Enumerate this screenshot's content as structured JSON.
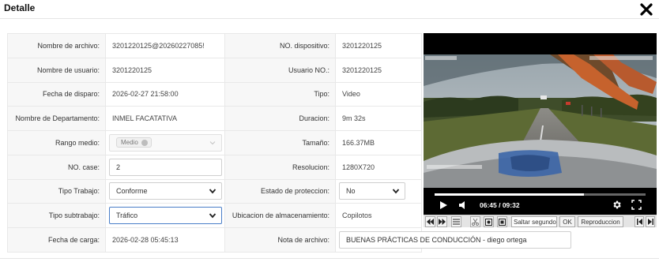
{
  "dialog": {
    "title": "Detalle"
  },
  "rows": [
    {
      "l1": "Nombre de archivo:",
      "v1": "3201220125@20260227085!",
      "l2": "NO. dispositivo:",
      "v2": "3201220125"
    },
    {
      "l1": "Nombre de usuario:",
      "v1": "3201220125",
      "l2": "Usuario NO.:",
      "v2": "3201220125"
    },
    {
      "l1": "Fecha de disparo:",
      "v1": "2026-02-27 21:58:00",
      "l2": "Tipo:",
      "v2": "Video"
    },
    {
      "l1": "Nombre de Departamento:",
      "v1": "INMEL FACATATIVA",
      "l2": "Duracion:",
      "v2": "9m 32s"
    },
    {
      "l1": "Rango medio:",
      "v1": "Medio",
      "l2": "Tamaño:",
      "v2": "166.37MB"
    },
    {
      "l1": "NO. case:",
      "v1": "2",
      "l2": "Resolucion:",
      "v2": "1280X720"
    },
    {
      "l1": "Tipo Trabajo:",
      "v1": "Conforme",
      "l2": "Estado de proteccion:",
      "v2": "No"
    },
    {
      "l1": "Tipo subtrabajo:",
      "v1": "Tráfico",
      "l2": "Ubicacion de almacenamiento:",
      "v2": "Copilotos"
    },
    {
      "l1": "Fecha de carga:",
      "v1": "2026-02-28 05:45:13",
      "l2": "Nota de archivo:",
      "v2": "BUENAS PRÁCTICAS DE CONDUCCIÓN - diego ortega"
    }
  ],
  "player": {
    "time": "06:45 / 09:32",
    "progress": 0.708,
    "icons": [
      "play-icon",
      "volume-icon",
      "settings-icon",
      "fullscreen-icon"
    ]
  },
  "toolbar": {
    "skip_placeholder": "Saltar segundo",
    "ok_label": "OK",
    "playback_label": "Reproduccion"
  },
  "colors": {
    "focus_border": "#4a7ec8",
    "label_bg": "#f7f7f7",
    "player_bg": "#000000"
  }
}
